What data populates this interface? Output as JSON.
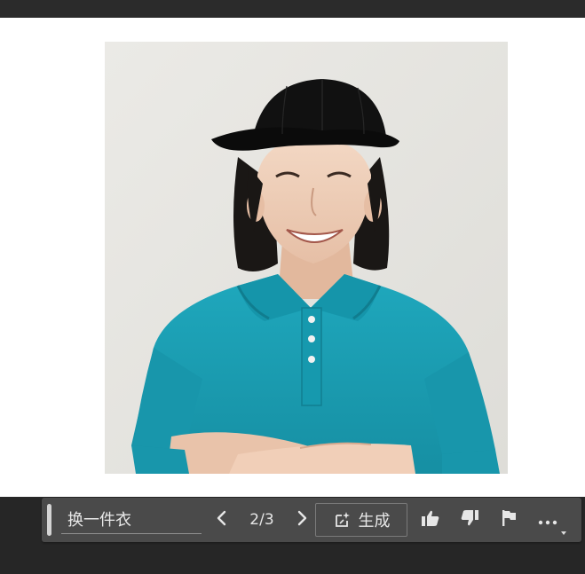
{
  "toolbar": {
    "prompt_value": "换一件衣",
    "page_current": "2",
    "page_total": "3",
    "page_separator": "/",
    "generate_label": "生成",
    "icons": {
      "prev": "chevron-left-icon",
      "next": "chevron-right-icon",
      "generate": "generate-sparkle-icon",
      "like": "thumbs-up-icon",
      "dislike": "thumbs-down-icon",
      "report": "flag-icon",
      "more": "more-horizontal-icon"
    }
  },
  "colors": {
    "top_bar": "#2b2b2b",
    "toolbar_bg": "#4a4a4a",
    "bottom_bg": "#262626",
    "shirt_teal": "#1a9fb5",
    "cap_black": "#111111",
    "backdrop": "#e8e6e1"
  }
}
